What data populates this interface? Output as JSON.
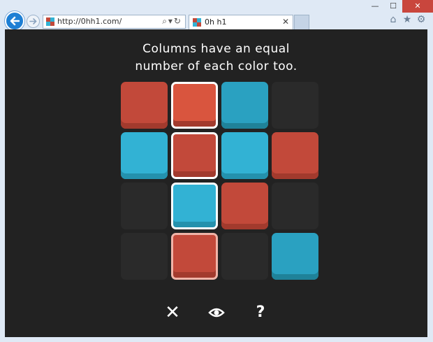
{
  "browser": {
    "url": "http://0hh1.com/",
    "tab_title": "0h h1",
    "window_controls": [
      "minimize",
      "maximize",
      "close"
    ],
    "toolbar_icons": [
      "home-icon",
      "star-icon",
      "gear-icon"
    ]
  },
  "game": {
    "instruction_line1": "Columns have an equal",
    "instruction_line2": "number of each color too.",
    "colors": {
      "red": "#c2493a",
      "blue": "#32b2d4",
      "empty": "#2a2a2a",
      "background": "#222222"
    },
    "grid": [
      [
        "red",
        "red",
        "blue",
        "empty"
      ],
      [
        "blue",
        "red",
        "blue",
        "red"
      ],
      [
        "empty",
        "blue",
        "red",
        "empty"
      ],
      [
        "empty",
        "red",
        "empty",
        "blue"
      ]
    ],
    "highlighted_column": 1,
    "controls": {
      "close": "✕",
      "hint": "👁",
      "help": "?"
    }
  }
}
